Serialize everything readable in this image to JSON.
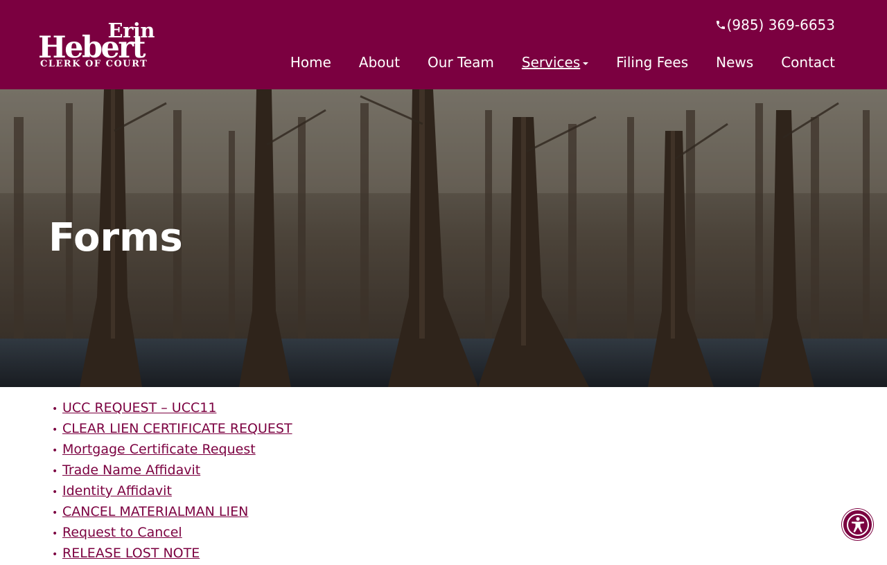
{
  "brand": {
    "logo_top": "Erin",
    "logo_main": "Hebert",
    "logo_sub": "CLERK OF COURT",
    "color": "#7b0040"
  },
  "header": {
    "phone": "(985) 369-6653",
    "nav": [
      {
        "label": "Home"
      },
      {
        "label": "About"
      },
      {
        "label": "Our Team"
      },
      {
        "label": "Services",
        "active": true,
        "dropdown": true
      },
      {
        "label": "Filing Fees"
      },
      {
        "label": "News"
      },
      {
        "label": "Contact"
      }
    ]
  },
  "hero": {
    "title": "Forms",
    "image": "cypress-swamp-forest-photo"
  },
  "forms": [
    "UCC REQUEST – UCC11",
    "CLEAR LIEN CERTIFICATE REQUEST",
    "Mortgage Certificate Request",
    "Trade Name Affidavit",
    "Identity Affidavit",
    "CANCEL MATERIALMAN LIEN",
    "Request to Cancel",
    "RELEASE LOST NOTE"
  ],
  "accessibility_button": {
    "icon": "accessibility-icon"
  }
}
